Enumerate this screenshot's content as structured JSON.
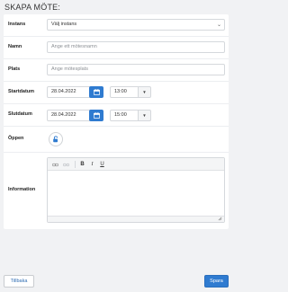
{
  "page": {
    "title": "SKAPA MÖTE:"
  },
  "form": {
    "instans": {
      "label": "Instans",
      "value": "Välj instans"
    },
    "namn": {
      "label": "Namn",
      "placeholder": "Ange ett mötesnamn"
    },
    "plats": {
      "label": "Plats",
      "placeholder": "Ange mötesplats"
    },
    "startdatum": {
      "label": "Startdatum",
      "date": "28.04.2022",
      "time": "13:00"
    },
    "slutdatum": {
      "label": "Slutdatum",
      "date": "28.04.2022",
      "time": "15:00"
    },
    "oppen": {
      "label": "Öppen",
      "icon": "unlock-icon"
    },
    "information": {
      "label": "Information",
      "toolbar": {
        "bold": "B",
        "italic": "I",
        "underline": "U"
      }
    }
  },
  "actions": {
    "back_label": "Tillbaka",
    "save_label": "Spara"
  },
  "colors": {
    "accent": "#2f7bd0",
    "background": "#f1f2f4"
  }
}
